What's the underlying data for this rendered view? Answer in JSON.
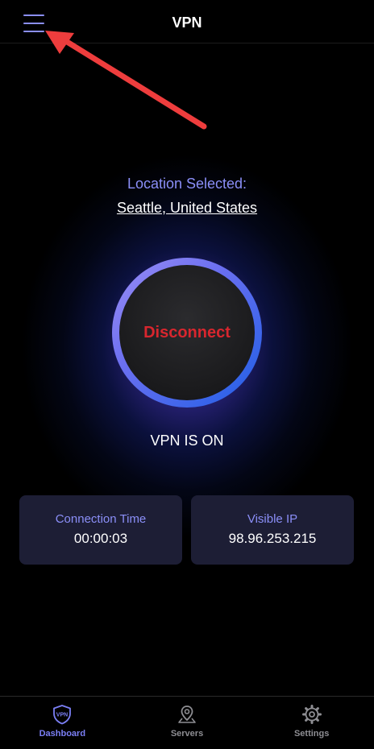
{
  "header": {
    "title": "VPN",
    "menu_icon": "hamburger-menu-icon"
  },
  "location": {
    "label": "Location Selected:",
    "value": "Seattle, United States"
  },
  "connect_button": {
    "label": "Disconnect"
  },
  "status": {
    "text": "VPN IS ON"
  },
  "stats": [
    {
      "label": "Connection Time",
      "value": "00:00:03"
    },
    {
      "label": "Visible IP",
      "value": "98.96.253.215"
    }
  ],
  "tabs": [
    {
      "label": "Dashboard",
      "icon": "vpn-shield-icon",
      "active": true
    },
    {
      "label": "Servers",
      "icon": "map-pin-icon",
      "active": false
    },
    {
      "label": "Settings",
      "icon": "gear-icon",
      "active": false
    }
  ],
  "colors": {
    "accent": "#7b7ff5",
    "disconnect_text": "#d8262e",
    "card_bg": "#1d1e35",
    "arrow": "#ee3d3d"
  }
}
